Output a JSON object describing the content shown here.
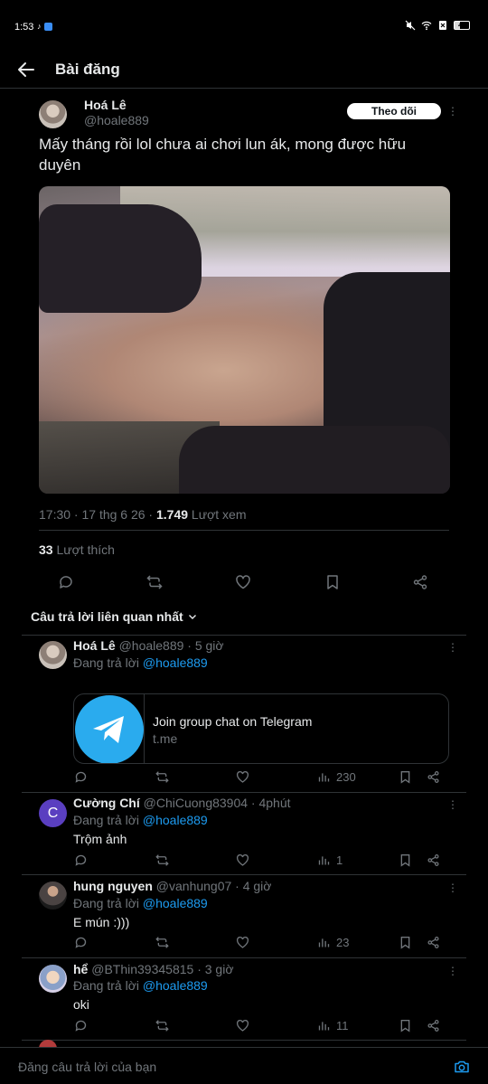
{
  "status_bar": {
    "time": "1:53",
    "battery": "40"
  },
  "header": {
    "title": "Bài đăng"
  },
  "post": {
    "author_name": "Hoá Lê",
    "author_handle": "@hoale889",
    "follow_label": "Theo dõi",
    "text": "Mấy tháng rồi lol chưa ai chơi lun ák, mong được hữu duyên",
    "timestamp": "17:30 · 17 thg 6 26 · ",
    "views_count": "1.749",
    "views_label": " Lượt xem",
    "likes_count": "33",
    "likes_label": " Lượt thích"
  },
  "replies_sort_label": "Câu trả lời liên quan nhất",
  "replies": [
    {
      "name": "Hoá Lê",
      "meta": " @hoale889 · 5 giờ",
      "replying_prefix": "Đang trả lời ",
      "replying_to": "@hoale889",
      "card_title": "Join group chat on Telegram",
      "card_domain": "t.me",
      "views": "230"
    },
    {
      "name": "Cường Chí",
      "meta": " @ChiCuong83904 · 4phút",
      "avatar_letter": "C",
      "replying_prefix": "Đang trả lời ",
      "replying_to": "@hoale889",
      "text": "Trộm ảnh",
      "views": "1"
    },
    {
      "name": "hung nguyen",
      "meta": " @vanhung07 · 4 giờ",
      "replying_prefix": "Đang trả lời ",
      "replying_to": "@hoale889",
      "text": "E mún :)))",
      "views": "23"
    },
    {
      "name": "hể",
      "meta": " @BThin39345815 · 3 giờ",
      "replying_prefix": "Đang trả lời ",
      "replying_to": "@hoale889",
      "text": "oki",
      "views": "11"
    }
  ],
  "compose": {
    "placeholder": "Đăng câu trả lời của bạn"
  },
  "colors": {
    "background": "#000000",
    "accent": "#1d9bf0",
    "muted": "#71767b",
    "divider": "#2f3336",
    "telegram": "#2aabee"
  }
}
